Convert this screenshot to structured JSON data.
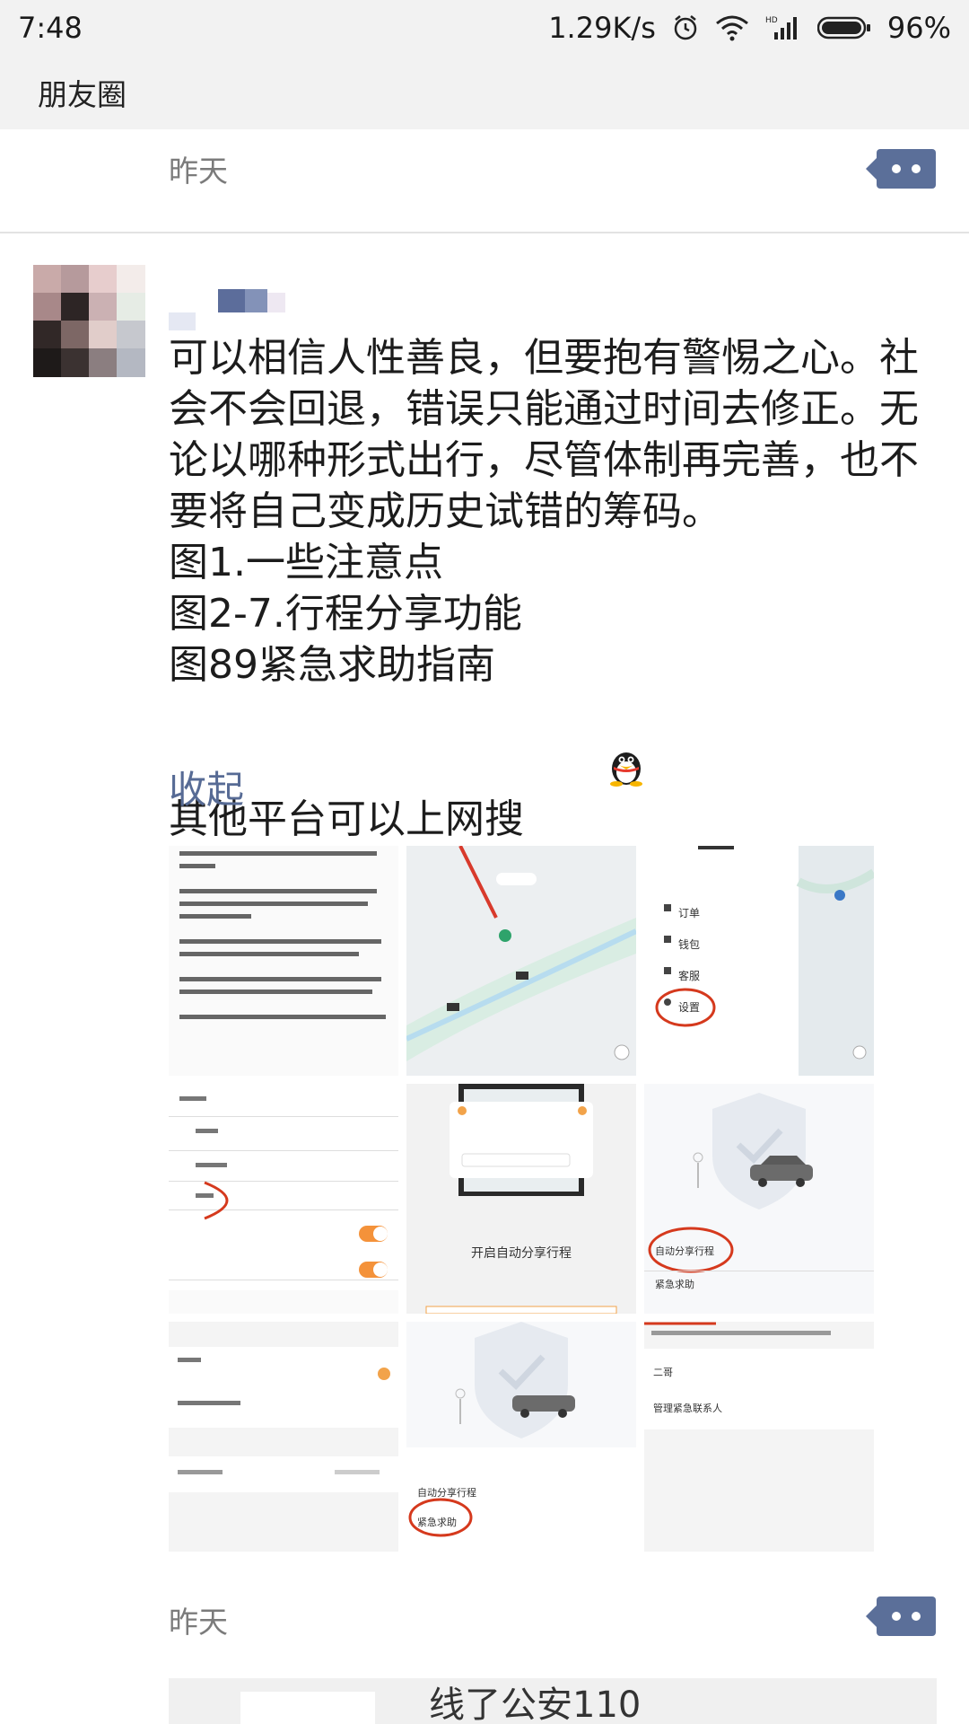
{
  "status_bar": {
    "time": "7:48",
    "network_speed": "1.29K/s",
    "battery": "96%",
    "icons": [
      "alarm-icon",
      "wifi-icon",
      "hd-signal-icon",
      "battery-icon"
    ]
  },
  "header": {
    "title": "朋友圈"
  },
  "feed": {
    "first_item": {
      "time": "昨天"
    },
    "post": {
      "text": "可以相信人性善良，但要抱有警惕之心。社会不会回退，错误只能通过时间去修正。无论以哪种形式出行，尽管体制再完善，也不要将自己变成历史试错的筹码。\n图1.一些注意点\n图2-7.行程分享功能\n图89紧急求助指南\n其他平台可以上网搜",
      "emoji": "penguin-emoji",
      "collapse_label": "收起",
      "time": "昨天",
      "images": [
        {
          "id": "img1",
          "caption": "safety tips list"
        },
        {
          "id": "img2",
          "caption": "map screen"
        },
        {
          "id": "img3",
          "caption": "settings menu with 设置 circled"
        },
        {
          "id": "img4",
          "caption": "settings list with toggles"
        },
        {
          "id": "img5",
          "caption": "开启自动分享行程"
        },
        {
          "id": "img6",
          "caption": "自动分享行程 circled"
        },
        {
          "id": "img7",
          "caption": "contact selection"
        },
        {
          "id": "img8",
          "caption": "紧急求助 circled"
        },
        {
          "id": "img9",
          "caption": "emergency contacts"
        }
      ],
      "image_texts": {
        "img5_title": "开启自动分享行程",
        "img3_menu": [
          "订单",
          "钱包",
          "客服",
          "设置"
        ],
        "img6_row1": "自动分享行程",
        "img6_row2": "紧急求助",
        "img8_row1": "自动分享行程",
        "img8_row2": "紧急求助",
        "img9_row1": "二哥",
        "img9_row2": "管理紧急联系人"
      }
    },
    "next_item": {
      "preview_text": "线了公安110"
    }
  },
  "colors": {
    "link": "#576b95",
    "comment_button": "#5b6f99",
    "header_bg": "#f2f2f2"
  }
}
